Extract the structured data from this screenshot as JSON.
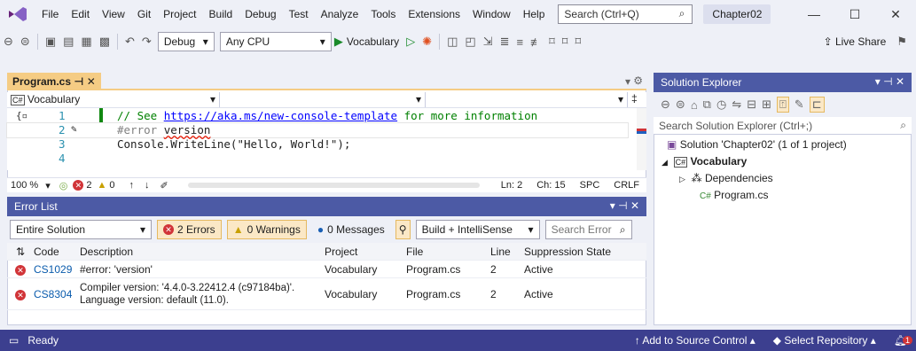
{
  "menubar": {
    "items": [
      "File",
      "Edit",
      "View",
      "Git",
      "Project",
      "Build",
      "Debug",
      "Test",
      "Analyze",
      "Tools",
      "Extensions",
      "Window",
      "Help"
    ],
    "search_placeholder": "Search (Ctrl+Q)",
    "solution_name": "Chapter02"
  },
  "toolbar": {
    "config": "Debug",
    "platform": "Any CPU",
    "run_target": "Vocabulary",
    "live_share": "Live Share"
  },
  "editor": {
    "tab_label": "Program.cs",
    "nav_project": "Vocabulary",
    "lines": [
      {
        "num": "1",
        "text": "// See https://aka.ms/new-console-template for more information"
      },
      {
        "num": "2",
        "text": "#error version"
      },
      {
        "num": "3",
        "text": "Console.WriteLine(\"Hello, World!\");"
      },
      {
        "num": "4",
        "text": ""
      }
    ],
    "comment_prefix": "// See ",
    "comment_link": "https://aka.ms/new-console-template",
    "comment_suffix": " for more information",
    "pre_directive": "#error ",
    "pre_arg": "version",
    "line3": "Console.WriteLine(\"Hello, World!\");",
    "status": {
      "zoom": "100 %",
      "errors": "2",
      "warnings": "0",
      "ln": "Ln: 2",
      "ch": "Ch: 15",
      "spc": "SPC",
      "crlf": "CRLF"
    }
  },
  "error_list": {
    "title": "Error List",
    "scope": "Entire Solution",
    "errors_btn": "2 Errors",
    "warnings_btn": "0 Warnings",
    "messages_btn": "0 Messages",
    "source": "Build + IntelliSense",
    "search_placeholder": "Search Error",
    "headers": {
      "code": "Code",
      "description": "Description",
      "project": "Project",
      "file": "File",
      "line": "Line",
      "suppression": "Suppression State"
    },
    "rows": [
      {
        "code": "CS1029",
        "description": "#error: 'version'",
        "project": "Vocabulary",
        "file": "Program.cs",
        "line": "2",
        "state": "Active"
      },
      {
        "code": "CS8304",
        "description": "Compiler version: '4.4.0-3.22412.4 (c97184ba)'.",
        "description2": "Language version: default (11.0).",
        "project": "Vocabulary",
        "file": "Program.cs",
        "line": "2",
        "state": "Active"
      }
    ]
  },
  "solution_explorer": {
    "title": "Solution Explorer",
    "search_placeholder": "Search Solution Explorer (Ctrl+;)",
    "solution": "Solution 'Chapter02' (1 of 1 project)",
    "project": "Vocabulary",
    "dependencies": "Dependencies",
    "file": "Program.cs"
  },
  "statusbar": {
    "ready": "Ready",
    "source_control": "Add to Source Control",
    "repository": "Select Repository",
    "notifications": "1"
  }
}
